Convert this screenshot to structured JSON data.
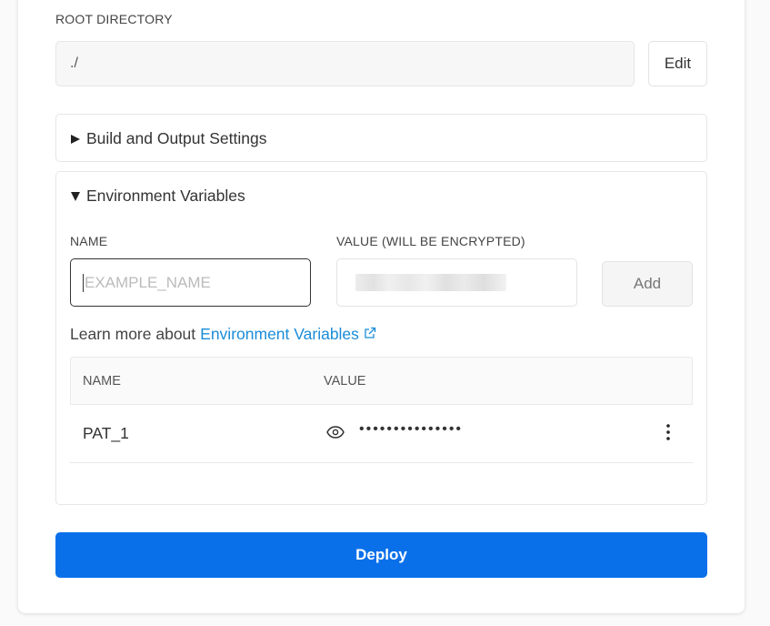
{
  "root_directory": {
    "label": "ROOT DIRECTORY",
    "value": "./",
    "edit_label": "Edit"
  },
  "build_settings": {
    "title": "Build and Output Settings",
    "expanded": false
  },
  "env_vars": {
    "title": "Environment Variables",
    "expanded": true,
    "name_label": "NAME",
    "value_label": "VALUE (WILL BE ENCRYPTED)",
    "name_placeholder": "EXAMPLE_NAME",
    "add_label": "Add",
    "learn_prefix": "Learn more about",
    "learn_link": "Environment Variables",
    "table": {
      "columns": [
        "NAME",
        "VALUE"
      ],
      "rows": [
        {
          "name": "PAT_1",
          "value_masked": "•••••••••••••••"
        }
      ]
    }
  },
  "deploy_label": "Deploy",
  "colors": {
    "accent": "#0a70ea",
    "link": "#1a8cd8"
  }
}
